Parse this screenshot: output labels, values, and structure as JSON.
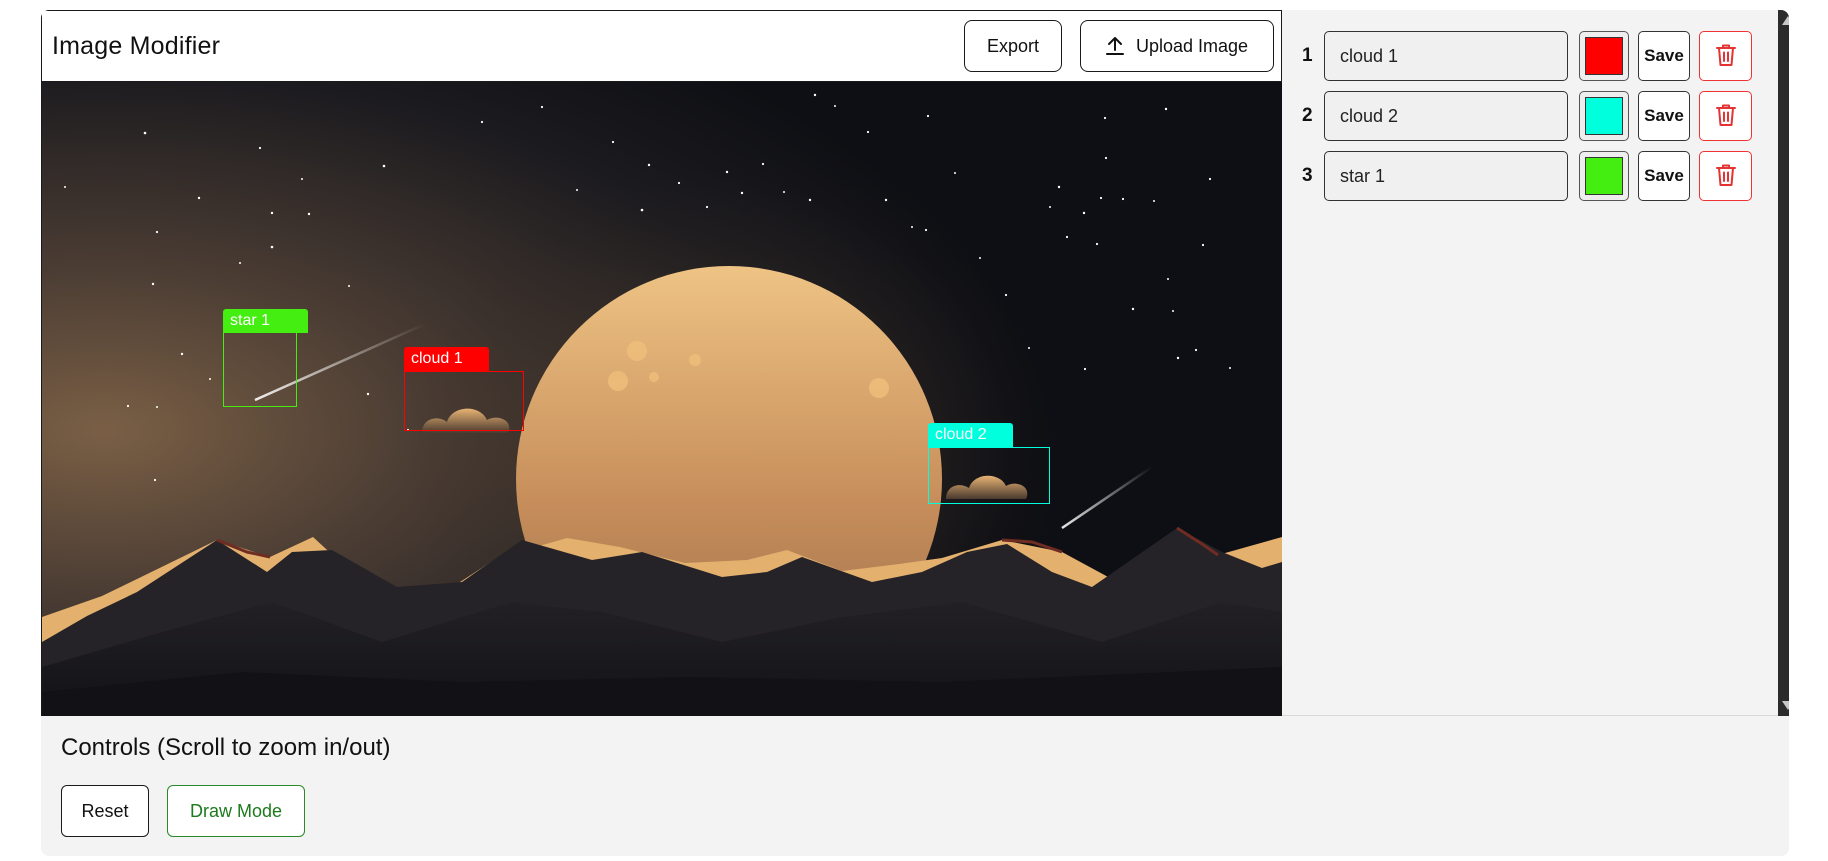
{
  "app": {
    "title": "Image Modifier",
    "export_label": "Export",
    "upload_label": "Upload Image"
  },
  "annotations": [
    {
      "index": "1",
      "label": "cloud 1",
      "color": "#ff0000",
      "save_label": "Save"
    },
    {
      "index": "2",
      "label": "cloud 2",
      "color": "#00ffdd",
      "save_label": "Save"
    },
    {
      "index": "3",
      "label": "star 1",
      "color": "#44ee11",
      "save_label": "Save"
    }
  ],
  "canvas_boxes": [
    {
      "label": "star 1",
      "color": "#44ee11"
    },
    {
      "label": "cloud 1",
      "color": "#ff0000"
    },
    {
      "label": "cloud 2",
      "color": "#00ffdd"
    }
  ],
  "controls": {
    "title": "Controls (Scroll to zoom in/out)",
    "reset_label": "Reset",
    "draw_mode_label": "Draw Mode"
  },
  "colors": {
    "delete_red": "#e33333",
    "draw_mode_green": "#1d7a1d"
  },
  "icons": {
    "upload": "upload-arrow-icon",
    "delete": "trash-icon"
  }
}
